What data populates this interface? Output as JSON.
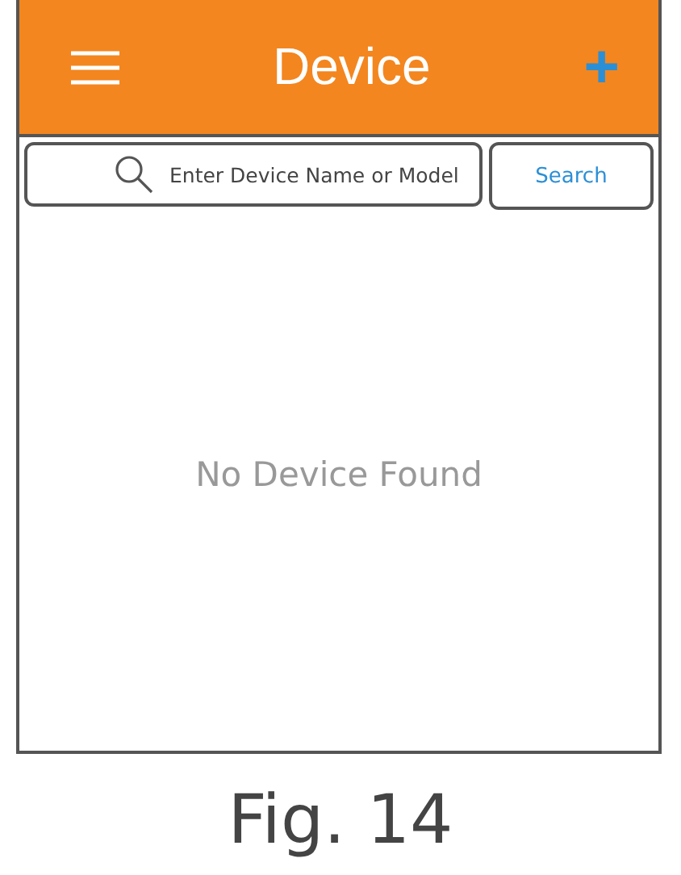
{
  "header": {
    "title": "Device",
    "add_icon": "+"
  },
  "search": {
    "placeholder": "Enter Device Name or Model",
    "button": "Search"
  },
  "empty_message": "No Device Found",
  "caption": "Fig. 14"
}
